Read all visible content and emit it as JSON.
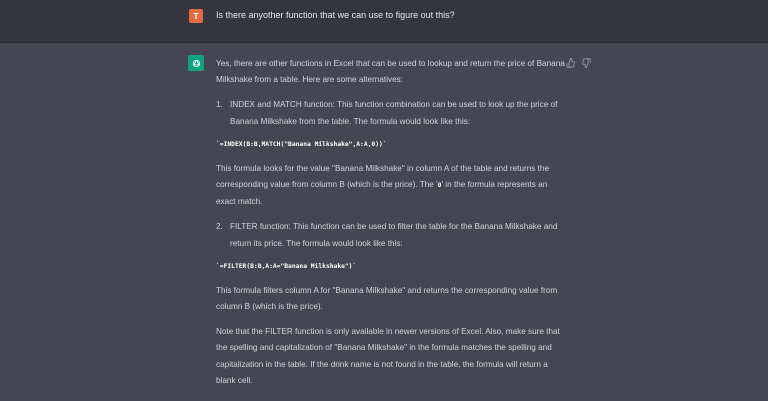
{
  "user": {
    "avatar_letter": "T",
    "message": "Is there anyother function that we can use to figure out this?"
  },
  "assistant": {
    "intro": "Yes, there are other functions in Excel that can be used to lookup and return the price of Banana Milkshake from a table. Here are some alternatives:",
    "item1": {
      "number": "1.",
      "text": "INDEX and MATCH function: This function combination can be used to look up the price of Banana Milkshake from the table. The formula would look like this:"
    },
    "code1": "`=INDEX(B:B,MATCH(\"Banana Milkshake\",A:A,0))`",
    "para1_a": "This formula looks for the value \"Banana Milkshake\" in column A of the table and returns the corresponding value from column B (which is the price). The '",
    "para1_code": "0",
    "para1_b": "' in the formula represents an exact match.",
    "item2": {
      "number": "2.",
      "text": "FILTER function: This function can be used to filter the table for the Banana Milkshake and return its price. The formula would look like this:"
    },
    "code2": "`=FILTER(B:B,A:A=\"Banana Milkshake\")`",
    "para2": "This formula filters column A for \"Banana Milkshake\" and returns the corresponding value from column B (which is the price).",
    "para3": "Note that the FILTER function is only available in newer versions of Excel. Also, make sure that the spelling and capitalization of \"Banana Milkshake\" in the formula matches the spelling and capitalization in the table. If the drink name is not found in the table, the formula will return a blank cell."
  },
  "icons": {
    "assistant_avatar": "openai-logo-icon",
    "thumbs_up": "thumbs-up-icon",
    "thumbs_down": "thumbs-down-icon"
  },
  "colors": {
    "user_bg": "#343541",
    "assistant_bg": "#444654",
    "user_avatar": "#e46c43",
    "gpt_avatar": "#10a37f"
  }
}
